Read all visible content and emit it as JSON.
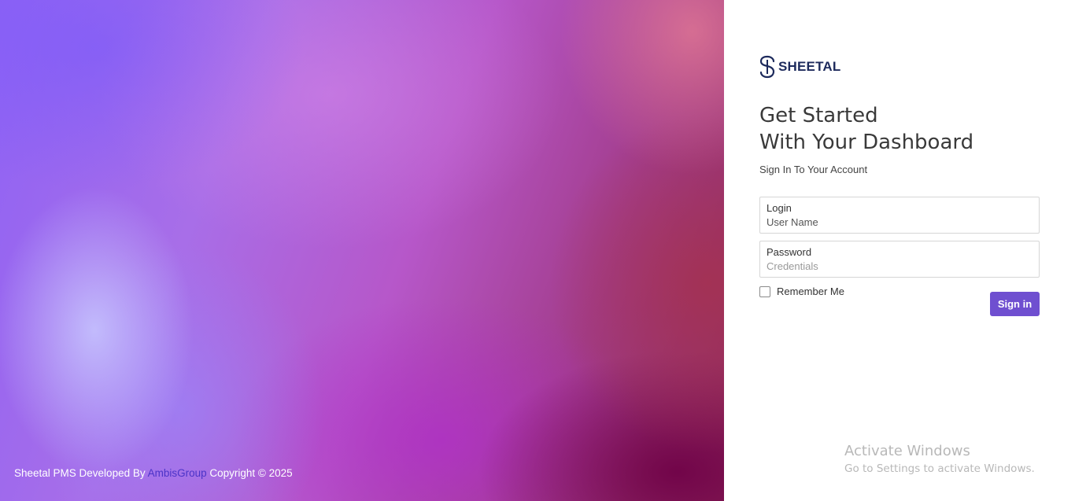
{
  "hero": {
    "footer_prefix": "Sheetal PMS Developed By ",
    "footer_link": "AmbisGroup",
    "footer_suffix": " Copyright © 2025"
  },
  "brand": {
    "logo_icon": "sheetal-logo-icon",
    "name": "SHEETAL",
    "color": "#1d2a5c"
  },
  "heading": {
    "line1": "Get Started",
    "line2": "With Your Dashboard",
    "subtitle": "Sign In To Your Account"
  },
  "form": {
    "login_label": "Login",
    "login_placeholder": "User Name",
    "password_label": "Password",
    "password_placeholder": "Credentials",
    "remember_label": "Remember Me",
    "remember_checked": false,
    "submit_label": "Sign in"
  },
  "colors": {
    "accent": "#6f4fd0",
    "link": "#4b33c8"
  },
  "watermark": {
    "title": "Activate Windows",
    "subtitle": "Go to Settings to activate Windows."
  }
}
